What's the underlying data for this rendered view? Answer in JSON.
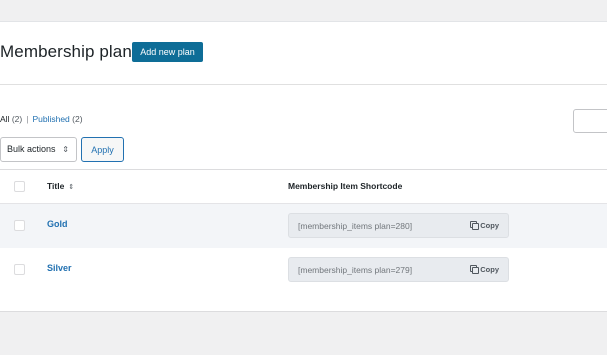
{
  "page": {
    "title": "Membership plans",
    "add_new_label": "Add new plan"
  },
  "filters": {
    "all_label": "All",
    "all_count": "(2)",
    "separator": "|",
    "published_label": "Published",
    "published_count": "(2)"
  },
  "bulk": {
    "select_label": "Bulk actions",
    "apply_label": "Apply"
  },
  "table": {
    "columns": {
      "title": "Title",
      "shortcode": "Membership Item Shortcode"
    },
    "rows": [
      {
        "name": "Gold",
        "shortcode": "[membership_items plan=280]",
        "copy_label": "Copy"
      },
      {
        "name": "Silver",
        "shortcode": "[membership_items plan=279]",
        "copy_label": "Copy"
      }
    ]
  },
  "colors": {
    "primary": "#0e6d97",
    "link": "#2271b1",
    "background": "#f0f0f1"
  }
}
